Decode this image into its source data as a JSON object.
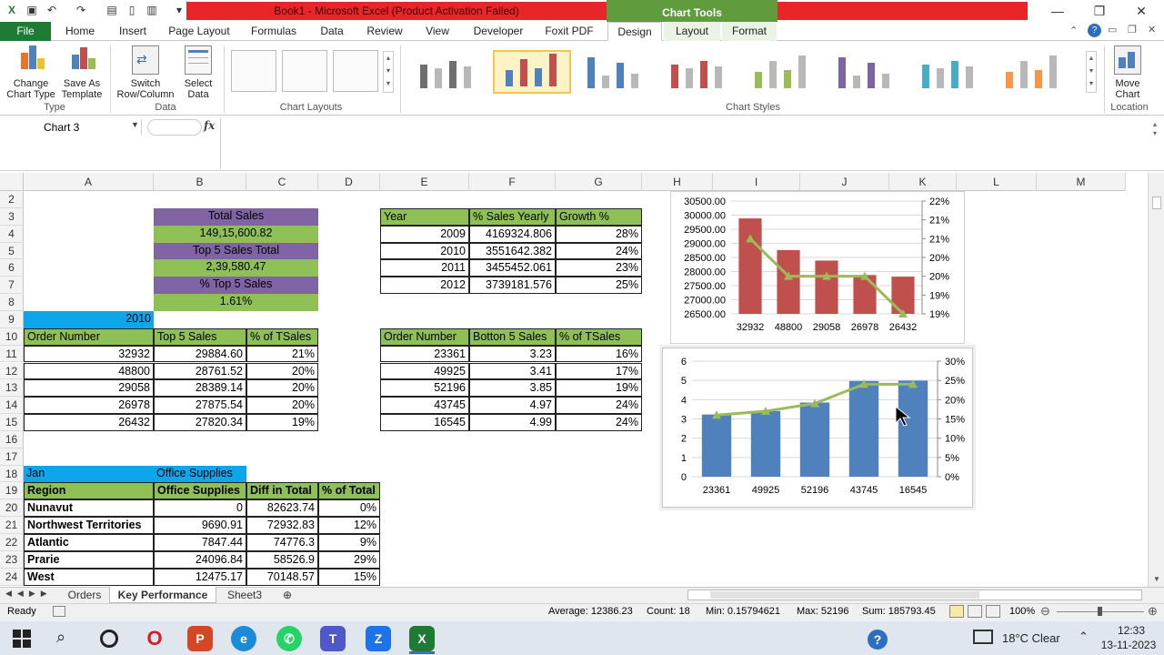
{
  "window": {
    "title": "Book1  -  Microsoft Excel (Product Activation Failed)",
    "chart_tools": "Chart Tools"
  },
  "tabs": [
    "File",
    "Home",
    "Insert",
    "Page Layout",
    "Formulas",
    "Data",
    "Review",
    "View",
    "Developer",
    "Foxit PDF",
    "Design",
    "Layout",
    "Format"
  ],
  "ribbon": {
    "change_type": [
      "Change",
      "Chart Type"
    ],
    "save_template": [
      "Save As",
      "Template"
    ],
    "switch": [
      "Switch",
      "Row/Column"
    ],
    "select_data": [
      "Select",
      "Data"
    ],
    "move_chart": [
      "Move",
      "Chart"
    ],
    "groups": {
      "type": "Type",
      "data": "Data",
      "layouts": "Chart Layouts",
      "styles": "Chart Styles",
      "location": "Location"
    },
    "style_colors": [
      "#6f6f6f",
      "#4f81bd",
      "#4f81bd",
      "#c0504d",
      "#9bbb59",
      "#8064a2",
      "#4bacc6",
      "#f79646"
    ]
  },
  "formula_bar": {
    "name_box": "Chart 3",
    "fx": "fx"
  },
  "columns": [
    "A",
    "B",
    "C",
    "D",
    "E",
    "F",
    "G",
    "H",
    "I",
    "J",
    "K",
    "L",
    "M"
  ],
  "rows": [
    "2",
    "3",
    "4",
    "5",
    "6",
    "7",
    "8",
    "9",
    "10",
    "11",
    "12",
    "13",
    "14",
    "15",
    "16",
    "17",
    "18",
    "19",
    "20",
    "21",
    "22",
    "23",
    "24"
  ],
  "summary": {
    "total_sales_label": "Total Sales",
    "total_sales": "149,15,600.82",
    "top5_total_label": "Top 5 Sales Total",
    "top5_total": "2,39,580.47",
    "pct_top5_label": "% Top 5 Sales",
    "pct_top5": "1.61%"
  },
  "year_label": "2010",
  "top5": {
    "headers": [
      "Order Number",
      "Top 5 Sales",
      "% of TSales"
    ],
    "rows": [
      [
        "32932",
        "29884.60",
        "21%"
      ],
      [
        "48800",
        "28761.52",
        "20%"
      ],
      [
        "29058",
        "28389.14",
        "20%"
      ],
      [
        "26978",
        "27875.54",
        "20%"
      ],
      [
        "26432",
        "27820.34",
        "19%"
      ]
    ]
  },
  "yearly": {
    "headers": [
      "Year",
      "% Sales Yearly",
      "Growth %"
    ],
    "rows": [
      [
        "2009",
        "4169324.806",
        "28%"
      ],
      [
        "2010",
        "3551642.382",
        "24%"
      ],
      [
        "2011",
        "3455452.061",
        "23%"
      ],
      [
        "2012",
        "3739181.576",
        "25%"
      ]
    ]
  },
  "bottom5": {
    "headers": [
      "Order Number",
      "Botton 5 Sales",
      "% of TSales"
    ],
    "rows": [
      [
        "23361",
        "3.23",
        "16%"
      ],
      [
        "49925",
        "3.41",
        "17%"
      ],
      [
        "52196",
        "3.85",
        "19%"
      ],
      [
        "43745",
        "4.97",
        "24%"
      ],
      [
        "16545",
        "4.99",
        "24%"
      ]
    ]
  },
  "region": {
    "month": "Jan",
    "category": "Office Supplies",
    "headers": [
      "Region",
      "Office Supplies",
      "Diff in Total",
      "% of Total"
    ],
    "rows": [
      [
        "Nunavut",
        "0",
        "82623.74",
        "0%"
      ],
      [
        "Northwest Territories",
        "9690.91",
        "72932.83",
        "12%"
      ],
      [
        "Atlantic",
        "7847.44",
        "74776.3",
        "9%"
      ],
      [
        "Prarie",
        "24096.84",
        "58526.9",
        "29%"
      ],
      [
        "West",
        "12475.17",
        "70148.57",
        "15%"
      ]
    ]
  },
  "chart_data": [
    {
      "type": "bar",
      "categories": [
        "32932",
        "48800",
        "29058",
        "26978",
        "26432"
      ],
      "series": [
        {
          "values": [
            29884.6,
            28761.52,
            28389.14,
            27875.54,
            27820.34
          ],
          "color": "#c0504d"
        },
        {
          "type": "line",
          "axis": "secondary",
          "values": [
            0.21,
            0.2,
            0.2,
            0.2,
            0.19
          ],
          "color": "#9bbb59"
        }
      ],
      "ylim": [
        26500,
        30500
      ],
      "yticks": [
        "30500.00",
        "30000.00",
        "29500.00",
        "29000.00",
        "28500.00",
        "28000.00",
        "27500.00",
        "27000.00",
        "26500.00"
      ],
      "y2ticks": [
        "22%",
        "21%",
        "21%",
        "20%",
        "20%",
        "19%",
        "19%"
      ]
    },
    {
      "type": "bar",
      "categories": [
        "23361",
        "49925",
        "52196",
        "43745",
        "16545"
      ],
      "series": [
        {
          "values": [
            3.23,
            3.41,
            3.85,
            4.97,
            4.99
          ],
          "color": "#4f81bd"
        },
        {
          "type": "line",
          "axis": "secondary",
          "values": [
            0.16,
            0.17,
            0.19,
            0.24,
            0.24
          ],
          "color": "#9bbb59"
        }
      ],
      "ylim": [
        0,
        6
      ],
      "yticks": [
        "6",
        "5",
        "4",
        "3",
        "2",
        "1",
        "0"
      ],
      "y2ticks": [
        "30%",
        "25%",
        "20%",
        "15%",
        "10%",
        "5%",
        "0%"
      ]
    }
  ],
  "sheets": [
    "Orders",
    "Key Performance",
    "Sheet3"
  ],
  "status": {
    "ready": "Ready",
    "average": "Average: 12386.23",
    "count": "Count: 18",
    "min": "Min: 0.15794621",
    "max": "Max: 52196",
    "sum": "Sum: 185793.45",
    "zoom": "100%"
  },
  "taskbar": {
    "weather": "18°C  Clear",
    "time": "12:33",
    "date": "13-11-2023"
  }
}
